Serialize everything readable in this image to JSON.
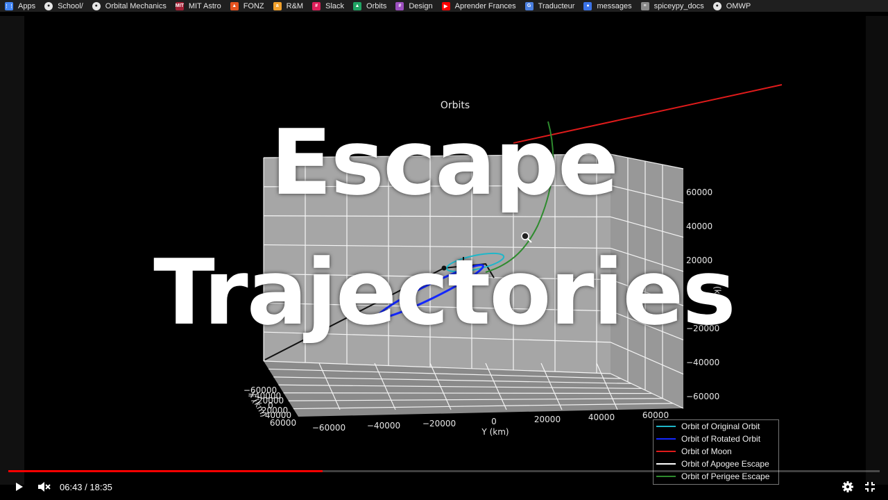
{
  "bookmarks": [
    {
      "label": "Apps",
      "icon": "apps-grid-icon",
      "color": "#4285f4"
    },
    {
      "label": "School/",
      "icon": "globe-icon",
      "color": "#bbbbbb"
    },
    {
      "label": "Orbital Mechanics",
      "icon": "globe-icon",
      "color": "#bbbbbb"
    },
    {
      "label": "MIT Astro",
      "icon": "mit-icon",
      "color": "#a31f34"
    },
    {
      "label": "FONZ",
      "icon": "fonz-icon",
      "color": "#e8531f"
    },
    {
      "label": "R&M",
      "icon": "amazon-icon",
      "color": "#f2a12b"
    },
    {
      "label": "Slack",
      "icon": "slack-icon",
      "color": "#e01e5a"
    },
    {
      "label": "Orbits",
      "icon": "google-drive-icon",
      "color": "#1fa463"
    },
    {
      "label": "Design",
      "icon": "slack-icon",
      "color": "#9c4fbf"
    },
    {
      "label": "Aprender Frances",
      "icon": "youtube-icon",
      "color": "#ff0000"
    },
    {
      "label": "Traducteur",
      "icon": "translate-icon",
      "color": "#4a7fe0"
    },
    {
      "label": "messages",
      "icon": "messages-icon",
      "color": "#3b73e8"
    },
    {
      "label": "spiceypy_docs",
      "icon": "document-icon",
      "color": "#8a8a8a"
    },
    {
      "label": "OMWP",
      "icon": "globe-icon",
      "color": "#bbbbbb"
    }
  ],
  "overlay": {
    "line1": "Escape",
    "line2": "Trajectories"
  },
  "chart_data": {
    "type": "line",
    "subtype": "3d",
    "title": "Orbits",
    "xlabel": "X (km)",
    "ylabel": "Y (km)",
    "zlabel": "Z (km)",
    "x_ticks": [
      "−60000",
      "−40000",
      "−20000",
      "0",
      "20000",
      "40000",
      "60000"
    ],
    "y_ticks": [
      "−60000",
      "−40000",
      "−20000",
      "0",
      "20000",
      "40000",
      "60000"
    ],
    "z_ticks": [
      "−60000",
      "−40000",
      "−20000",
      "0",
      "20000",
      "40000",
      "60000"
    ],
    "grid": true,
    "legend_position": "bottom-right",
    "series": [
      {
        "name": "Orbit of Original Orbit",
        "color": "#1fb7c9"
      },
      {
        "name": "Orbit of Rotated Orbit",
        "color": "#1428ff"
      },
      {
        "name": "Orbit of Moon",
        "color": "#e01b1b"
      },
      {
        "name": "Orbit of Apogee Escape",
        "color": "#ffffff"
      },
      {
        "name": "Orbit of Perigee Escape",
        "color": "#2e8b2e"
      }
    ]
  },
  "player": {
    "time_current": "06:43",
    "time_total": "18:35",
    "time_text": "06:43 / 18:35",
    "progress": 0.361,
    "accent": "#ff0000"
  }
}
